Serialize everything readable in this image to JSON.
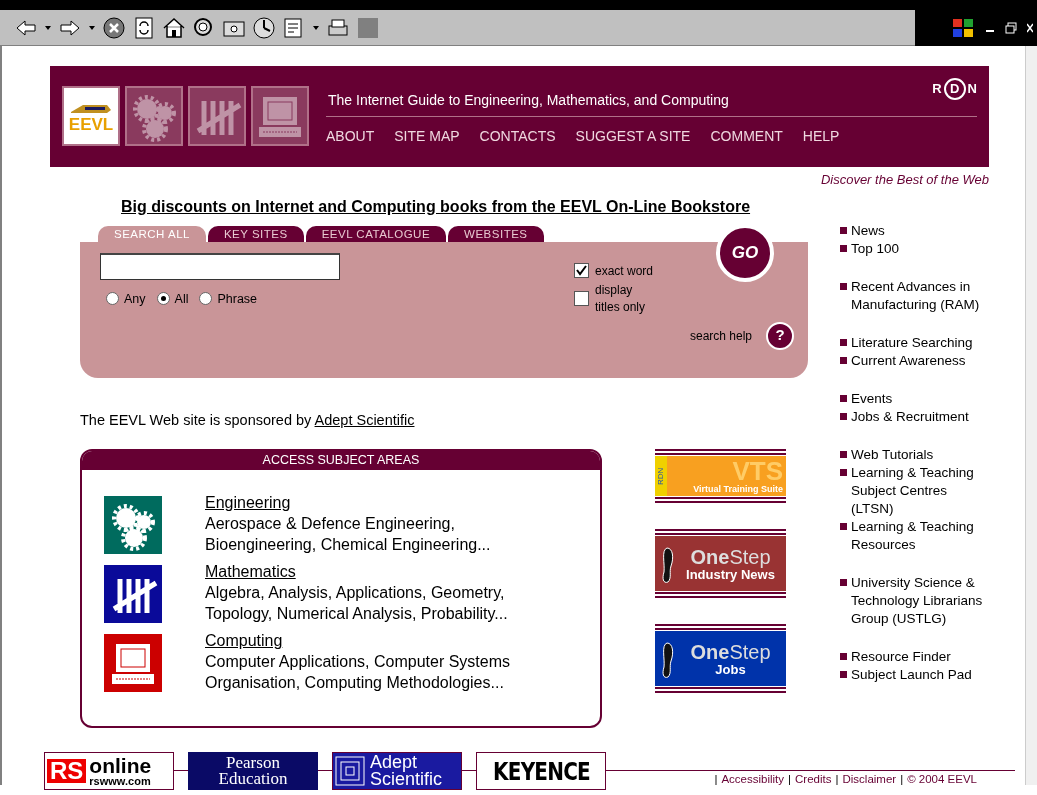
{
  "header": {
    "logo_text": "EEVL",
    "title": "The Internet Guide to Engineering, Mathematics, and Computing",
    "rdn_logo": [
      "R",
      "D",
      "N"
    ],
    "nav": [
      "ABOUT",
      "SITE MAP",
      "CONTACTS",
      "SUGGEST A SITE",
      "COMMENT",
      "HELP"
    ]
  },
  "tagline": "Discover the Best of the Web",
  "promo_link": "Big discounts on Internet and Computing books from the EEVL On-Line Bookstore",
  "search": {
    "tabs": [
      {
        "label": "SEARCH ALL",
        "selected": true
      },
      {
        "label": "KEY SITES",
        "selected": false
      },
      {
        "label": "EEVL CATALOGUE",
        "selected": false
      },
      {
        "label": "WEBSITES",
        "selected": false
      }
    ],
    "go_button": "GO",
    "modes": [
      {
        "label": "Any",
        "selected": false
      },
      {
        "label": "All",
        "selected": true
      },
      {
        "label": "Phrase",
        "selected": false
      }
    ],
    "options": [
      {
        "label": "exact word",
        "checked": true
      },
      {
        "label": "display titles only",
        "checked": false
      }
    ],
    "help_label": "search help",
    "help_button": "?"
  },
  "sponsor": {
    "text": "The EEVL Web site is sponsored by",
    "link": "Adept Scientific"
  },
  "subjects": {
    "title": "ACCESS SUBJECT AREAS",
    "items": [
      {
        "kind": "gears",
        "color": "#006b5e",
        "name": "Engineering",
        "lines": [
          "Aerospace & Defence Engineering,",
          "Bioengineering, Chemical Engineering..."
        ]
      },
      {
        "kind": "tally",
        "color": "#0a0a99",
        "name": "Mathematics",
        "lines": [
          "Algebra, Analysis, Applications, Geometry,",
          "Topology, Numerical Analysis, Probability..."
        ]
      },
      {
        "kind": "computer",
        "color": "#cc0000",
        "name": "Computing",
        "lines": [
          "Computer Applications, Computer Systems",
          "Organisation, Computing Methodologies..."
        ]
      }
    ]
  },
  "banners": [
    {
      "kind": "vts",
      "big": "VTS",
      "small": "Virtual Training Suite",
      "tag": "RDN"
    },
    {
      "kind": "onestep",
      "color": "#993333",
      "one": "One",
      "step": "Step",
      "sub": "Industry News"
    },
    {
      "kind": "onestep",
      "color": "#0033aa",
      "one": "One",
      "step": "Step",
      "sub": "Jobs"
    }
  ],
  "sidebar": [
    [
      "News",
      "Top 100"
    ],
    [
      "Recent Advances in Manufacturing (RAM)"
    ],
    [
      "Literature Searching",
      "Current Awareness"
    ],
    [
      "Events",
      "Jobs & Recruitment"
    ],
    [
      "Web Tutorials",
      "Learning & Teaching Subject Centres (LTSN)",
      "Learning & Teaching Resources"
    ],
    [
      "University Science & Technology Librarians Group (USTLG)"
    ],
    [
      "Resource Finder",
      "Subject Launch Pad"
    ]
  ],
  "footer": {
    "sponsors": [
      {
        "kind": "rs",
        "parts": [
          "RS",
          "online",
          "rswww.com"
        ]
      },
      {
        "kind": "pearson",
        "parts": [
          "Pearson",
          "Education"
        ]
      },
      {
        "kind": "adept",
        "parts": [
          "Adept",
          "Scientific"
        ]
      },
      {
        "kind": "keyence",
        "parts": [
          "KEYENCE"
        ]
      }
    ],
    "links": [
      {
        "kind": "separator",
        "text": "|"
      },
      {
        "kind": "link",
        "text": "Accessibility"
      },
      {
        "kind": "separator",
        "text": "|"
      },
      {
        "kind": "link",
        "text": "Credits"
      },
      {
        "kind": "separator",
        "text": "|"
      },
      {
        "kind": "link",
        "text": "Disclaimer"
      },
      {
        "kind": "separator",
        "text": "|"
      },
      {
        "kind": "link",
        "text": "© 2004 EEVL"
      }
    ]
  }
}
